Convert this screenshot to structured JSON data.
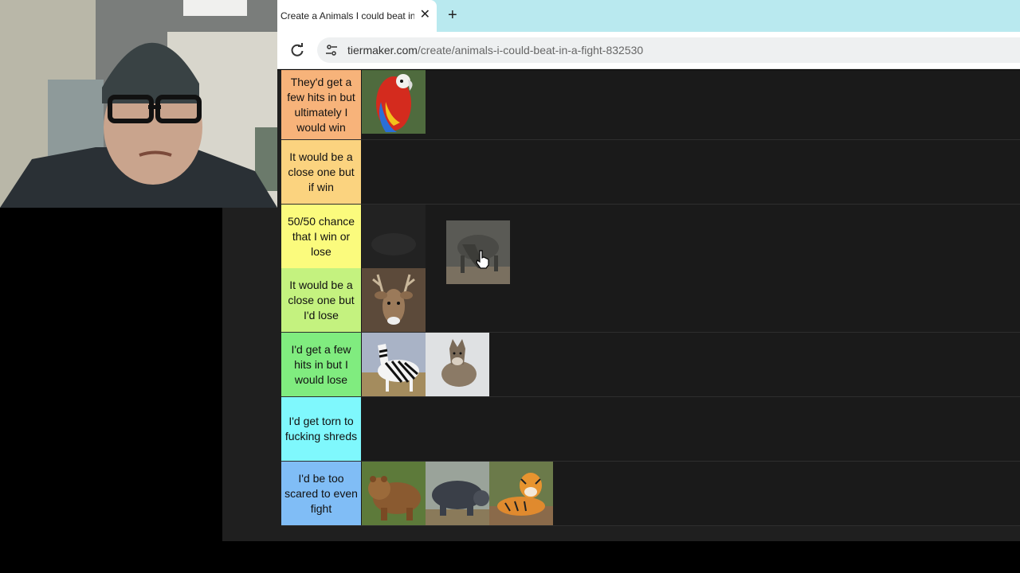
{
  "browser": {
    "tab_title": "Create a Animals I could beat in",
    "url_host": "tiermaker.com",
    "url_path": "/create/animals-i-could-beat-in-a-fight-832530"
  },
  "tiers": [
    {
      "label": "They'd get a few hits in but ultimately I would win",
      "color": "#f7b37a",
      "items": [
        "parrot"
      ]
    },
    {
      "label": "It would be a close one but if win",
      "color": "#fbd37f",
      "items": []
    },
    {
      "label": "50/50 chance that I win or lose",
      "color": "#fbfb7d",
      "items": [
        "dark-placeholder"
      ]
    },
    {
      "label": "It would be a close one but I'd lose",
      "color": "#c4f27f",
      "items": [
        "deer"
      ]
    },
    {
      "label": "I'd get a few hits in but I would lose",
      "color": "#80ec7f",
      "items": [
        "zebra",
        "wolf"
      ]
    },
    {
      "label": "I'd get torn to fucking shreds",
      "color": "#7ff8fd",
      "items": []
    },
    {
      "label": "I'd be too scared to even fight",
      "color": "#80bdf6",
      "items": [
        "bear",
        "hippo",
        "tiger"
      ]
    }
  ],
  "dragging_item": "komodo-dragon"
}
